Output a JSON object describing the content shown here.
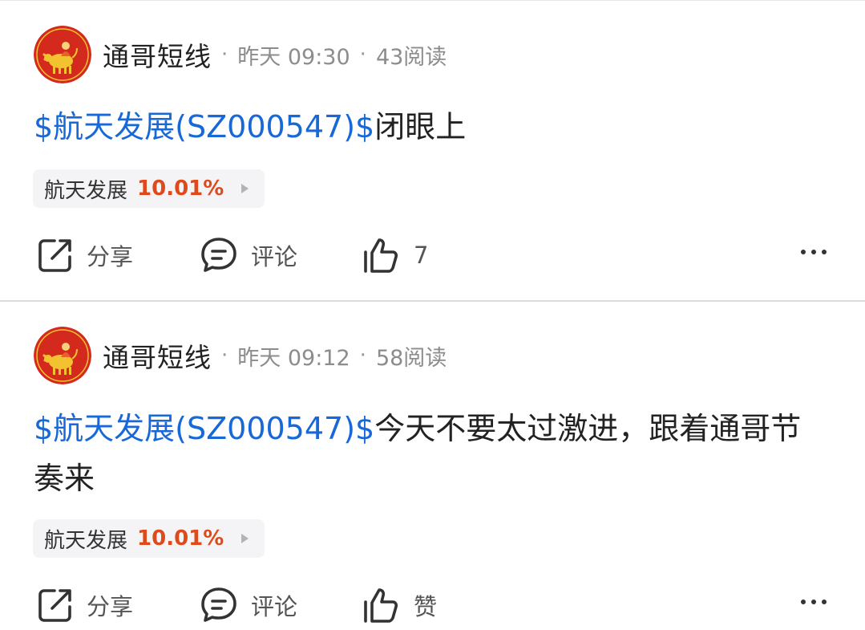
{
  "posts": [
    {
      "author": "通哥短线",
      "time": "昨天 09:30",
      "reads": "43阅读",
      "stock_link": "$航天发展(SZ000547)$",
      "text": "闭眼上",
      "stock_name": "航天发展",
      "stock_change": "10.01%",
      "share_label": "分享",
      "comment_label": "评论",
      "like_label": "7"
    },
    {
      "author": "通哥短线",
      "time": "昨天 09:12",
      "reads": "58阅读",
      "stock_link": "$航天发展(SZ000547)$",
      "text": "今天不要太过激进，跟着通哥节奏来",
      "stock_name": "航天发展",
      "stock_change": "10.01%",
      "share_label": "分享",
      "comment_label": "评论",
      "like_label": "赞"
    }
  ],
  "meta_separator": "·",
  "colors": {
    "link": "#1868d8",
    "gain": "#e04a1a",
    "avatar_bg": "#d42a1d",
    "avatar_figure": "#f2c230"
  },
  "icons": {
    "share": "share-icon",
    "comment": "comment-icon",
    "like": "thumbs-up-icon",
    "more": "more-dots-icon",
    "avatar": "ox-avatar"
  }
}
